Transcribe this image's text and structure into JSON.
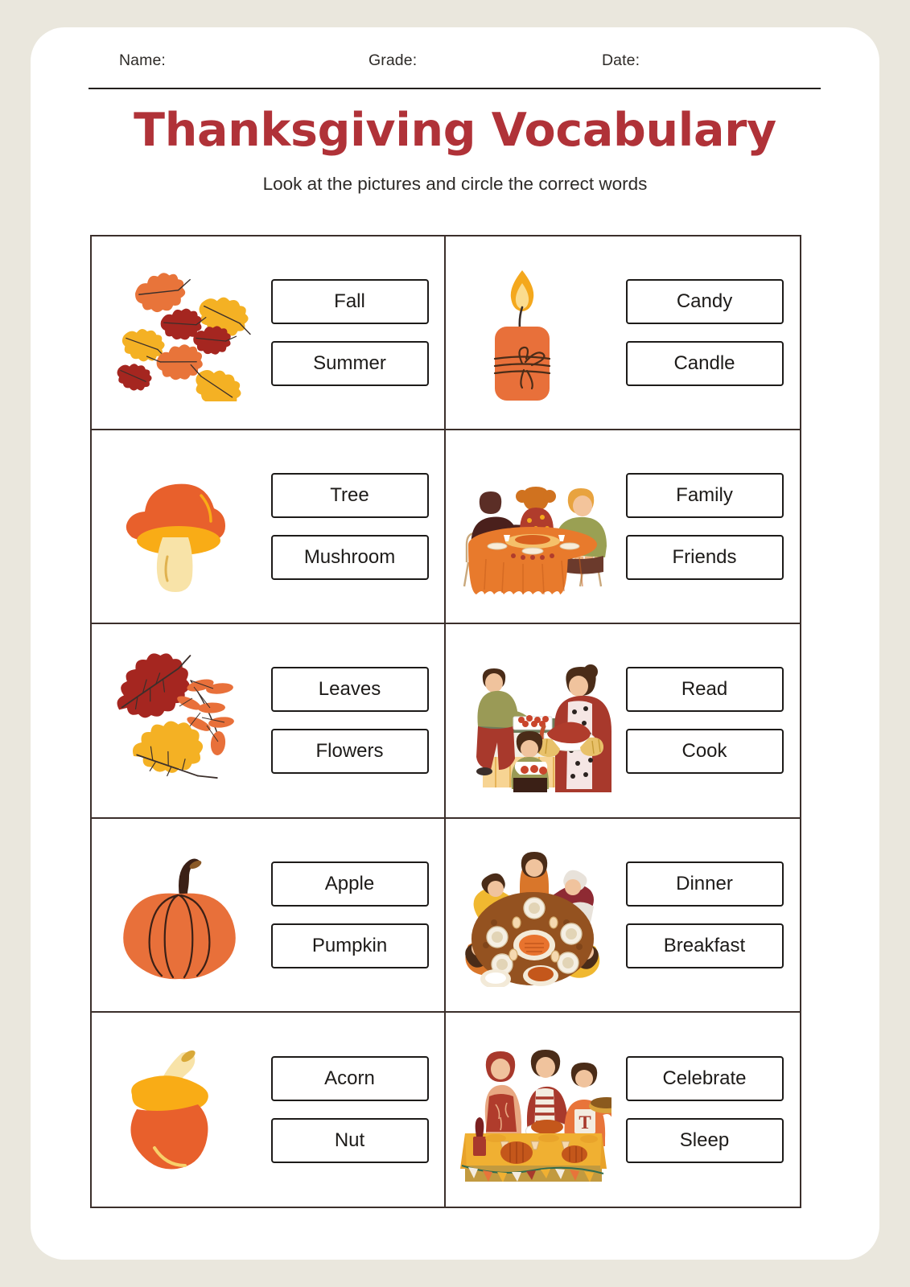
{
  "header": {
    "name_label": "Name:",
    "grade_label": "Grade:",
    "date_label": "Date:"
  },
  "title": "Thanksgiving Vocabulary",
  "subtitle": "Look at the pictures and circle the correct words",
  "colors": {
    "page_background": "#eae7dd",
    "sheet": "#ffffff",
    "title_red": "#b03238",
    "grid_line": "#3b2f2b",
    "box_border": "#1d1b19",
    "orange": "#e8703a",
    "deep_orange": "#e26a32",
    "yellow": "#f4a81d",
    "dark_red": "#a52620",
    "cream": "#f6e2ae",
    "brown": "#4a2c18"
  },
  "items": [
    {
      "id": "leaves-scatter",
      "icon": "falling-leaves-icon",
      "options": [
        "Fall",
        "Summer"
      ]
    },
    {
      "id": "candle",
      "icon": "candle-icon",
      "options": [
        "Candy",
        "Candle"
      ]
    },
    {
      "id": "mushroom",
      "icon": "mushroom-icon",
      "options": [
        "Tree",
        "Mushroom"
      ]
    },
    {
      "id": "family-table",
      "icon": "family-at-table-icon",
      "options": [
        "Family",
        "Friends"
      ]
    },
    {
      "id": "autumn-leaves",
      "icon": "autumn-leaves-icon",
      "options": [
        "Leaves",
        "Flowers"
      ]
    },
    {
      "id": "cooking",
      "icon": "cooking-turkey-icon",
      "options": [
        "Read",
        "Cook"
      ]
    },
    {
      "id": "pumpkin",
      "icon": "pumpkin-icon",
      "options": [
        "Apple",
        "Pumpkin"
      ]
    },
    {
      "id": "dinner-overhead",
      "icon": "dinner-table-overhead-icon",
      "options": [
        "Dinner",
        "Breakfast"
      ]
    },
    {
      "id": "acorn",
      "icon": "acorn-icon",
      "options": [
        "Acorn",
        "Nut"
      ]
    },
    {
      "id": "celebration",
      "icon": "thanksgiving-celebration-icon",
      "options": [
        "Celebrate",
        "Sleep"
      ]
    }
  ]
}
